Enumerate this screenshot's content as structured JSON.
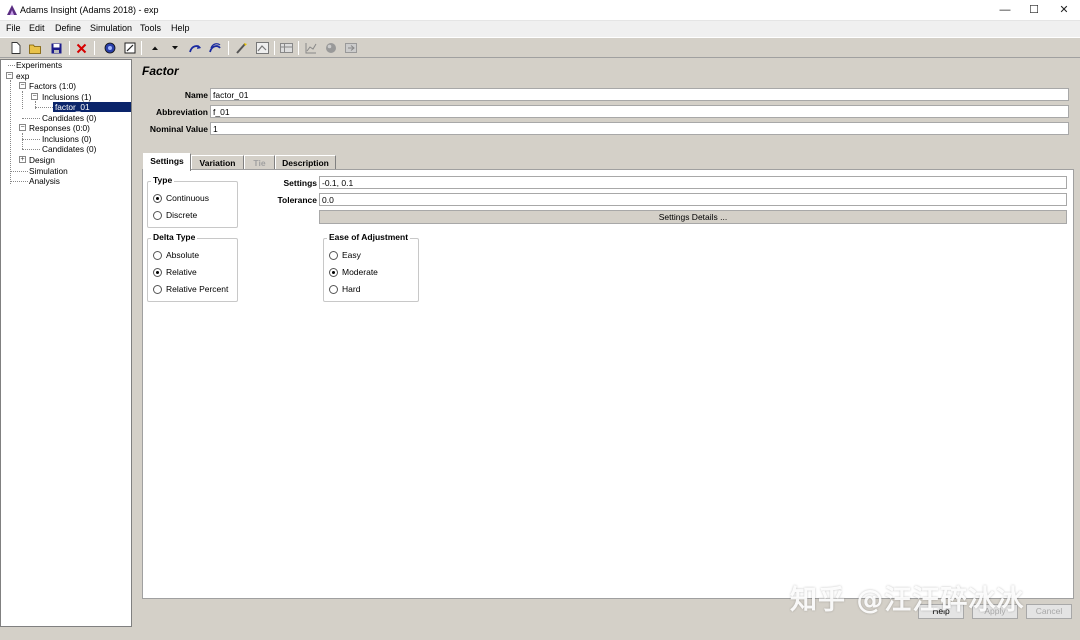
{
  "window": {
    "title": "Adams Insight (Adams 2018) - exp",
    "controls": {
      "minimize": "—",
      "maximize": "☐",
      "close": "✕"
    }
  },
  "menu": [
    "File",
    "Edit",
    "Define",
    "Simulation",
    "Tools",
    "Help"
  ],
  "toolbar": {
    "icons": [
      "new-file-icon",
      "open-folder-icon",
      "save-icon",
      "delete-icon",
      "globe-icon",
      "model-icon",
      "move-up-icon",
      "move-down-icon",
      "run-icon",
      "run-all-icon",
      "wand-icon",
      "chart-icon",
      "table-icon",
      "plot-icon",
      "sphere-icon",
      "export-icon"
    ]
  },
  "tree": {
    "experiments": "Experiments",
    "exp": "exp",
    "factors": "Factors (1:0)",
    "factor_inclusions": "Inclusions (1)",
    "selected_factor": "factor_01",
    "factor_candidates": "Candidates (0)",
    "responses": "Responses (0:0)",
    "response_inclusions": "Inclusions (0)",
    "response_candidates": "Candidates (0)",
    "design": "Design",
    "simulation": "Simulation",
    "analysis": "Analysis"
  },
  "factor": {
    "heading": "Factor",
    "name_label": "Name",
    "name_value": "factor_01",
    "abbreviation_label": "Abbreviation",
    "abbreviation_value": "f_01",
    "nominal_label": "Nominal Value",
    "nominal_value": "1"
  },
  "tabs": [
    {
      "label": "Settings",
      "active": true
    },
    {
      "label": "Variation"
    },
    {
      "label": "Tie",
      "disabled": true
    },
    {
      "label": "Description"
    }
  ],
  "settings_tab": {
    "type_group": {
      "title": "Type",
      "options": [
        "Continuous",
        "Discrete"
      ],
      "selected": "Continuous"
    },
    "delta_group": {
      "title": "Delta Type",
      "options": [
        "Absolute",
        "Relative",
        "Relative Percent"
      ],
      "selected": "Relative"
    },
    "settings_label": "Settings",
    "settings_value": "-0.1, 0.1",
    "tolerance_label": "Tolerance",
    "tolerance_value": "0.0",
    "details_button": "Settings Details ...",
    "ease_group": {
      "title": "Ease of Adjustment",
      "options": [
        "Easy",
        "Moderate",
        "Hard"
      ],
      "selected": "Moderate"
    }
  },
  "bottom_buttons": {
    "help": "Help",
    "apply": "Apply",
    "cancel": "Cancel"
  },
  "watermark": "知乎 @汪汪碎冰冰",
  "colors": {
    "selection": "#0a246a",
    "panel": "#d4d0c8",
    "app_icon": "#5a2d82"
  }
}
